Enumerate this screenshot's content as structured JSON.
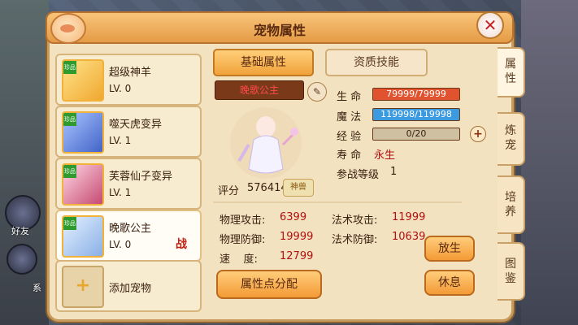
{
  "window": {
    "title": "宠物属性"
  },
  "tabs": {
    "basic": "基础属性",
    "aptitude": "资质技能"
  },
  "pets": [
    {
      "name": "超级神羊",
      "level": "LV. 0",
      "badge": "珍品"
    },
    {
      "name": "噬天虎变异",
      "level": "LV. 1",
      "badge": "珍品"
    },
    {
      "name": "芙蓉仙子变异",
      "level": "LV. 1",
      "badge": "珍品"
    },
    {
      "name": "晚歌公主",
      "level": "LV. 0",
      "badge": "珍品",
      "battle": "战"
    }
  ],
  "add_pet": {
    "icon": "+",
    "label": "添加宠物"
  },
  "selected": {
    "name": "晚歌公主",
    "score_label": "评分",
    "score": "576414",
    "score_tag": "神兽"
  },
  "attributes": {
    "hp_label": "生 命",
    "hp": "79999/79999",
    "hp_fraction": 1.0,
    "mp_label": "魔 法",
    "mp": "119998/119998",
    "mp_fraction": 1.0,
    "exp_label": "经 验",
    "exp": "0/20",
    "exp_fraction": 0.0,
    "life_label": "寿 命",
    "life": "永生",
    "battle_level_label": "参战等级",
    "battle_level": "1"
  },
  "stats": {
    "phys_atk_label": "物理攻击:",
    "phys_atk": "6399",
    "mag_atk_label": "法术攻击:",
    "mag_atk": "11999",
    "phys_def_label": "物理防御:",
    "phys_def": "19999",
    "mag_def_label": "法术防御:",
    "mag_def": "10639",
    "speed_label": "速    度:",
    "speed": "12799"
  },
  "buttons": {
    "release": "放生",
    "rest": "休息",
    "assign_points": "属性点分配"
  },
  "side_tabs": [
    "属性",
    "炼宠",
    "培养",
    "图鉴"
  ],
  "background": {
    "friend_label": "好友",
    "system_label": "系"
  },
  "colors": {
    "hp_bar": "#e0532e",
    "mp_bar": "#3c9ae0",
    "accent": "#f39a36"
  }
}
